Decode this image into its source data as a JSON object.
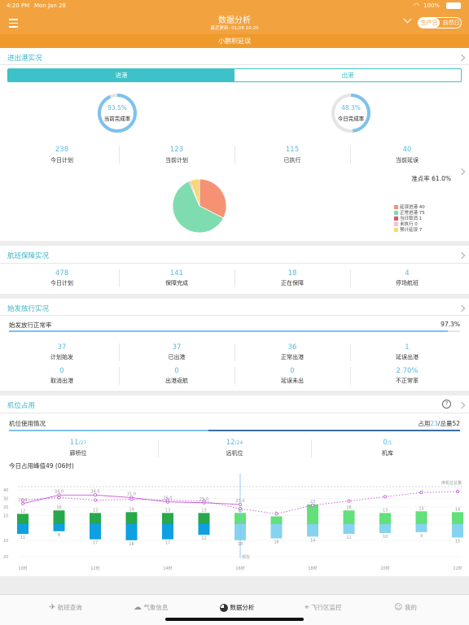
{
  "status_bar": {
    "time": "4:20 PM",
    "date": "Mon Jan 28",
    "battery": "100%"
  },
  "header": {
    "title": "数据分析",
    "subtitle": "最近更新: 01/28 16:20",
    "toggle_production": "生产日",
    "toggle_natural": "自然日"
  },
  "banner": {
    "text": "小鹏积延误"
  },
  "inout": {
    "title": "进出港实况",
    "tab_in": "进港",
    "tab_out": "出港",
    "ring_left": {
      "percent": "93.5%",
      "label": "当前完成率",
      "value": 0.935
    },
    "ring_right": {
      "percent": "48.3%",
      "label": "今日完成率",
      "value": 0.483
    },
    "stats": [
      {
        "value": "238",
        "label": "今日计划"
      },
      {
        "value": "123",
        "label": "当前计划"
      },
      {
        "value": "115",
        "label": "已执行"
      },
      {
        "value": "40",
        "label": "当前延误"
      }
    ],
    "on_time_rate": "准点率 61.0%",
    "pie": [
      {
        "label": "延误进港 40",
        "value": 40,
        "color": "#f59274"
      },
      {
        "label": "正常进港 75",
        "value": 75,
        "color": "#7fdcb0"
      },
      {
        "label": "当日取消 1",
        "value": 1,
        "color": "#e0556a"
      },
      {
        "label": "未执行 0",
        "value": 0,
        "color": "#f3c0d2"
      },
      {
        "label": "预计延误 7",
        "value": 7,
        "color": "#f7d77a"
      }
    ]
  },
  "guarantee": {
    "title": "航班保障实况",
    "stats": [
      {
        "value": "478",
        "label": "今日计划"
      },
      {
        "value": "141",
        "label": "保障完成"
      },
      {
        "value": "18",
        "label": "正在保障"
      },
      {
        "value": "4",
        "label": "停场航班"
      }
    ]
  },
  "departure": {
    "title": "始发放行实况",
    "rate_label": "始发放行正常率",
    "rate_value": "97.3%",
    "rate": 0.973,
    "row1": [
      {
        "value": "37",
        "label": "计划始发"
      },
      {
        "value": "37",
        "label": "已出港"
      },
      {
        "value": "36",
        "label": "正常出港"
      },
      {
        "value": "1",
        "label": "延误出港"
      }
    ],
    "row2": [
      {
        "value": "0",
        "label": "取消出港"
      },
      {
        "value": "0",
        "label": "出港返航"
      },
      {
        "value": "0",
        "label": "延误未出"
      },
      {
        "value": "2.70%",
        "label": "不正常率"
      }
    ]
  },
  "stands": {
    "title": "机位占用",
    "usage_label": "机位使用情况",
    "usage_used_label": "占用",
    "usage_used": "23",
    "usage_total_label": "/总量52",
    "usage_fraction": 0.442,
    "cells": [
      {
        "value": "11",
        "total": "/27",
        "label": "廊桥位"
      },
      {
        "value": "12",
        "total": "/24",
        "label": "远机位"
      },
      {
        "value": "0",
        "total": "/1",
        "label": "机库"
      }
    ],
    "peak_text": "今日占用峰值49 (06时)",
    "legend_text": "停机位总量"
  },
  "chart_data": {
    "type": "bar",
    "title": "",
    "x_labels": [
      "10时",
      "12时",
      "14时",
      "16时",
      "18时",
      "20时",
      "22时"
    ],
    "y_ticks_upper": [
      "40",
      "30",
      "20",
      "10"
    ],
    "y_ticks_lower": [
      "10",
      "20"
    ],
    "ylim_upper": [
      0,
      40
    ],
    "ylim_lower": [
      0,
      20
    ],
    "bars": [
      {
        "up": 12,
        "down": 11,
        "future": false
      },
      {
        "up": 16,
        "down": 8,
        "future": false
      },
      {
        "up": 13,
        "down": 17,
        "future": false
      },
      {
        "up": 14,
        "down": 18,
        "future": false
      },
      {
        "up": 13,
        "down": 17,
        "future": false
      },
      {
        "up": 13,
        "down": 12,
        "future": false
      },
      {
        "up": 13,
        "down": 18,
        "future": true
      },
      {
        "up": 9,
        "down": 16,
        "future": true
      },
      {
        "up": 23,
        "down": 14,
        "future": true
      },
      {
        "up": 16,
        "down": 11,
        "future": true
      },
      {
        "up": 13,
        "down": 10,
        "future": true
      },
      {
        "up": 15,
        "down": 9,
        "future": true
      },
      {
        "up": 14,
        "down": 15,
        "future": true
      }
    ],
    "line_solid": [
      {
        "x": 0,
        "y": 24.0
      },
      {
        "x": 1,
        "y": 34.0
      },
      {
        "x": 2,
        "y": 34.0
      },
      {
        "x": 3,
        "y": 31.0
      },
      {
        "x": 4,
        "y": 26.0
      },
      {
        "x": 5,
        "y": 25.0
      },
      {
        "x": 6,
        "y": 23.0
      }
    ],
    "line_dotted": [
      {
        "x": 0,
        "y": 28
      },
      {
        "x": 1,
        "y": 31
      },
      {
        "x": 2,
        "y": 28
      },
      {
        "x": 3,
        "y": 29
      },
      {
        "x": 4,
        "y": 28
      },
      {
        "x": 5,
        "y": 27
      },
      {
        "x": 6,
        "y": 18
      },
      {
        "x": 7,
        "y": 12
      },
      {
        "x": 8,
        "y": 22
      },
      {
        "x": 9,
        "y": 27
      },
      {
        "x": 10,
        "y": 32
      },
      {
        "x": 11,
        "y": 37
      },
      {
        "x": 12,
        "y": 38
      }
    ],
    "total_line": 49,
    "now_index": 6,
    "now_label": "现在",
    "colors": {
      "up": "#27a84a",
      "down": "#0ea0e3",
      "up_future": "#62e07a",
      "down_future": "#86d3ef",
      "line": "#c45ad8"
    }
  },
  "tabbar": [
    {
      "label": "航班查询",
      "icon": "plane-icon"
    },
    {
      "label": "气象信息",
      "icon": "cloud-icon"
    },
    {
      "label": "数据分析",
      "icon": "pie-chart-icon"
    },
    {
      "label": "飞行区监控",
      "icon": "location-icon"
    },
    {
      "label": "我的",
      "icon": "person-icon"
    }
  ]
}
